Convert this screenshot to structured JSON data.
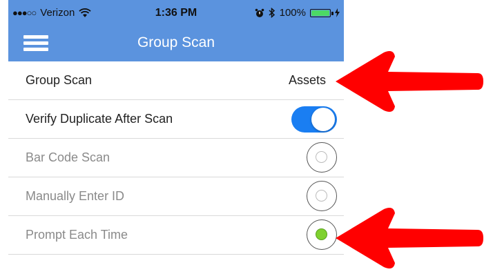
{
  "status_bar": {
    "signal": "●●●○○",
    "carrier": "Verizon",
    "time": "1:36 PM",
    "battery": "100%",
    "icons": [
      "wifi-icon",
      "alarm-icon",
      "bluetooth-icon",
      "battery-icon",
      "charging-icon"
    ]
  },
  "header": {
    "title": "Group Scan",
    "menu_icon": "hamburger-menu-icon"
  },
  "settings": {
    "group_scan": {
      "label": "Group Scan",
      "value": "Assets"
    },
    "verify_duplicate": {
      "label": "Verify Duplicate After Scan",
      "enabled": true
    },
    "scan_modes": [
      {
        "label": "Bar Code Scan",
        "selected": false
      },
      {
        "label": "Manually Enter ID",
        "selected": false
      },
      {
        "label": "Prompt Each Time",
        "selected": true
      }
    ]
  },
  "annotations": {
    "arrow_color": "#ff0000",
    "arrows": [
      "group-scan-value",
      "prompt-each-time-radio"
    ]
  },
  "colors": {
    "header": "#5b93de",
    "toggle_on": "#1a7ef2",
    "radio_selected": "#7fd12f"
  }
}
